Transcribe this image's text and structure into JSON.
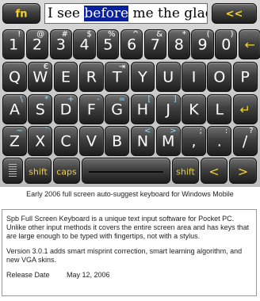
{
  "toolbar": {
    "fn_label": "fn",
    "input_prefix": "I see ",
    "input_highlight": "before",
    "input_suffix": " me the gladiat",
    "back_label": "<<"
  },
  "rows": [
    [
      {
        "main": "1",
        "alt": "!"
      },
      {
        "main": "2",
        "alt": "@"
      },
      {
        "main": "3",
        "alt": "#"
      },
      {
        "main": "4",
        "alt": "$"
      },
      {
        "main": "5",
        "alt": "%"
      },
      {
        "main": "6",
        "alt": "^"
      },
      {
        "main": "7",
        "alt": "&"
      },
      {
        "main": "8",
        "alt": "*"
      },
      {
        "main": "9",
        "alt": "("
      },
      {
        "main": "0",
        "alt": ")"
      },
      {
        "main": "←",
        "alt": ""
      }
    ],
    [
      {
        "main": "Q",
        "alt": ""
      },
      {
        "main": "W",
        "alt": "€"
      },
      {
        "main": "E",
        "alt": ""
      },
      {
        "main": "R",
        "alt": ""
      },
      {
        "main": "T",
        "alt": "⇥"
      },
      {
        "main": "Y",
        "alt": ""
      },
      {
        "main": "U",
        "alt": ""
      },
      {
        "main": "I",
        "alt": ""
      },
      {
        "main": "O",
        "alt": ""
      },
      {
        "main": "P",
        "alt": ""
      }
    ],
    [
      {
        "main": "A",
        "alt": "\\"
      },
      {
        "main": "S",
        "alt": "*"
      },
      {
        "main": "D",
        "alt": "+"
      },
      {
        "main": "F",
        "alt": "-"
      },
      {
        "main": "G",
        "alt": "="
      },
      {
        "main": "H",
        "alt": "["
      },
      {
        "main": "J",
        "alt": "]"
      },
      {
        "main": "K",
        "alt": ""
      },
      {
        "main": "L",
        "alt": ""
      },
      {
        "main": "↵",
        "alt": ""
      }
    ],
    [
      {
        "main": "Z",
        "alt": "~"
      },
      {
        "main": "X",
        "alt": "`"
      },
      {
        "main": "C",
        "alt": ""
      },
      {
        "main": "V",
        "alt": ""
      },
      {
        "main": "B",
        "alt": ""
      },
      {
        "main": "N",
        "alt": "<"
      },
      {
        "main": "M",
        "alt": ">"
      },
      {
        "main": ",",
        "alt": ";"
      },
      {
        "main": ".",
        "alt": ":"
      },
      {
        "main": "/",
        "alt": "?"
      }
    ]
  ],
  "bottom": {
    "shift_left": "shift",
    "caps": "caps",
    "shift_right": "shift",
    "left_arrow": "<",
    "right_arrow": ">"
  },
  "caption": "Early 2006 full screen auto-suggest keyboard for Windows Mobile",
  "description": {
    "paragraph1": "Spb Full Screen Keyboard is a unique text input software for Pocket PC. Unlike other input methods it covers the entire screen area and has keys that are large enough to be typed with fingertips, not with a stylus.",
    "paragraph2": "Version 3.0.1 adds smart misprint correction, smart learning algorithm, and new VGA skins.",
    "release_label": "Release Date",
    "release_date": "May 12, 2006"
  },
  "colors": {
    "accent_yellow": "#f2d22e",
    "highlight_blue": "#0a1f9a",
    "alt_cyan": "#8fe0ff"
  },
  "icons": {
    "handwriting": "handwriting-icon",
    "backspace": "backspace-icon",
    "enter": "enter-icon"
  }
}
